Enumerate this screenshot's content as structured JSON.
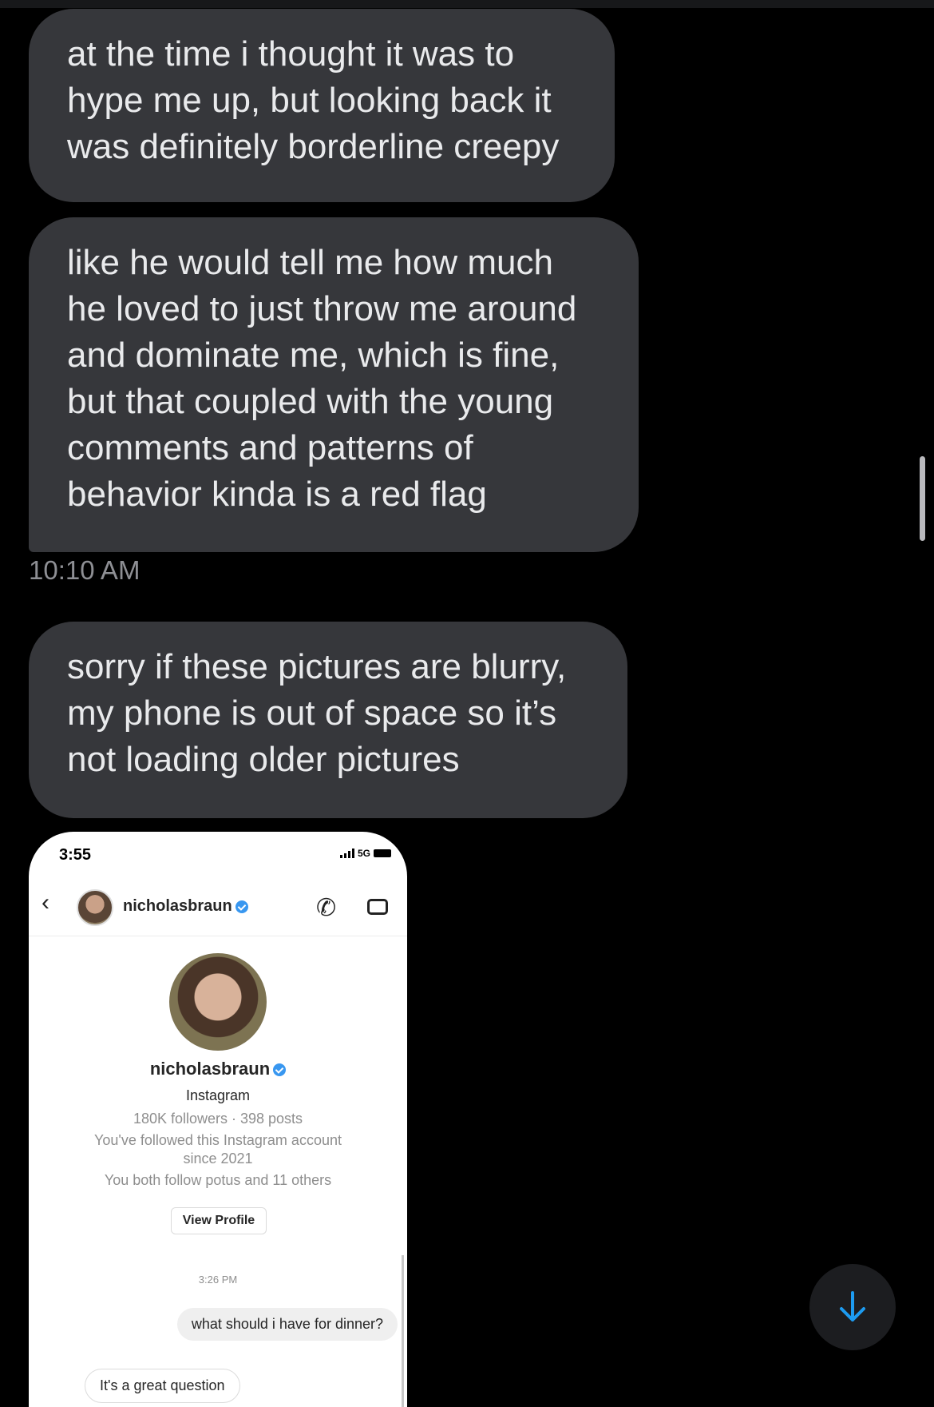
{
  "messages": [
    {
      "lines": [
        "at the time i thought it was to",
        "hype me up, but looking back it",
        "was definitely borderline creepy"
      ]
    },
    {
      "lines": [
        "like he would tell me how much",
        "he loved to just throw me around",
        "and dominate me, which is fine,",
        "but that coupled with the young",
        "comments and patterns of",
        "behavior kinda is a red flag"
      ]
    },
    {
      "lines": [
        "sorry if these pictures are blurry,",
        "my phone is out of space so it’s",
        "not loading older pictures"
      ]
    }
  ],
  "timestamp": "10:10 AM",
  "attachment": {
    "status_time": "3:55",
    "network": "5G",
    "header_username": "nicholasbraun",
    "profile_name": "nicholasbraun",
    "profile_platform": "Instagram",
    "profile_stats": "180K followers · 398 posts",
    "follow_note_1": "You've followed this Instagram account",
    "follow_note_2": "since 2021",
    "mutual_note": "You both follow potus and 11 others",
    "view_profile_label": "View Profile",
    "chat_time": "3:26 PM",
    "outgoing_message": "what should i have for dinner?",
    "incoming_message": "It's a great question"
  },
  "icons": {
    "back": "chevron-left-icon",
    "call": "phone-icon",
    "video": "video-call-icon",
    "verified": "verified-badge-icon",
    "scroll_down": "arrow-down-icon"
  },
  "colors": {
    "background": "#000000",
    "bubble": "#36373b",
    "text": "#e9eaec",
    "timestamp": "#8e8f94",
    "accent": "#1d9bf0"
  }
}
